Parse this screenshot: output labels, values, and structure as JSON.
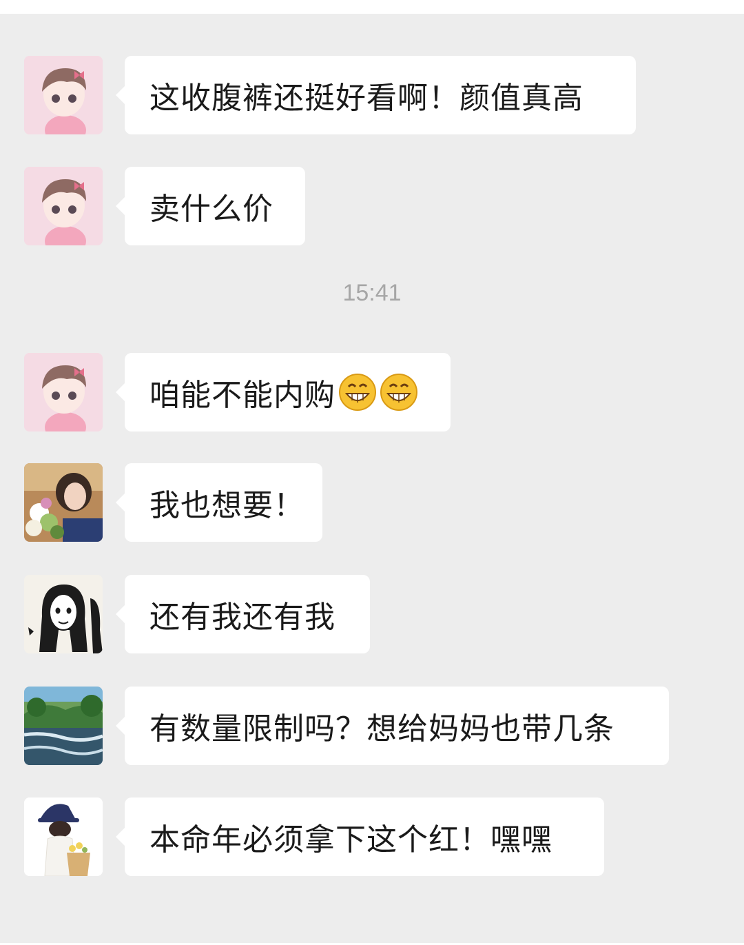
{
  "timestamp": "15:41",
  "messages": [
    {
      "avatar": "girl-cartoon-avatar",
      "text": "这收腹裤还挺好看啊！颜值真高"
    },
    {
      "avatar": "girl-cartoon-avatar",
      "text": "卖什么价"
    },
    {
      "avatar": "girl-cartoon-avatar",
      "text": "咱能不能内购",
      "emojis": [
        "grinning-face-emoji",
        "grinning-face-emoji"
      ]
    },
    {
      "avatar": "woman-with-flowers-photo-avatar",
      "text": "我也想要！"
    },
    {
      "avatar": "sketch-girl-avatar",
      "text": "还有我还有我"
    },
    {
      "avatar": "river-landscape-avatar",
      "text": "有数量限制吗？想给妈妈也带几条"
    },
    {
      "avatar": "woman-in-bucket-hat-avatar",
      "text": "本命年必须拿下这个红！嘿嘿"
    }
  ],
  "colors": {
    "chat_background": "#ededed",
    "bubble_background": "#ffffff",
    "text": "#1a1a1a",
    "timestamp": "#a6a6a6"
  }
}
